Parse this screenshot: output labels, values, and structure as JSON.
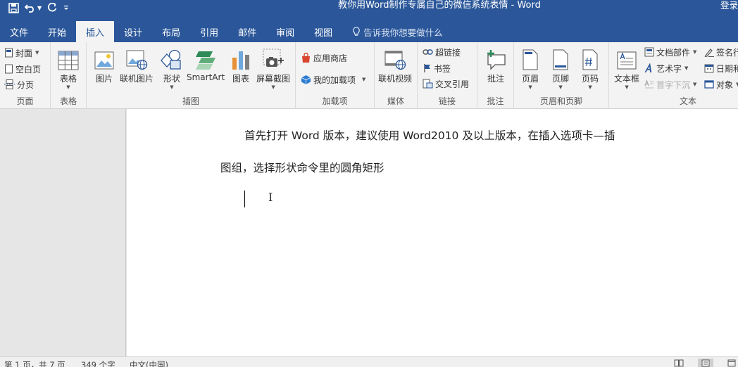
{
  "titlebar": {
    "title": "教你用Word制作专属自己的微信系统表情 - Word",
    "login": "登录"
  },
  "tabs": {
    "file": "文件",
    "items": [
      "开始",
      "插入",
      "设计",
      "布局",
      "引用",
      "邮件",
      "审阅",
      "视图"
    ],
    "active": "插入",
    "tellme": "告诉我你想要做什么"
  },
  "ribbon": {
    "pages": {
      "label": "页面",
      "cover": "封面",
      "blank": "空白页",
      "break": "分页"
    },
    "tables": {
      "label": "表格",
      "table": "表格"
    },
    "illustrations": {
      "label": "插图",
      "picture": "图片",
      "online_picture": "联机图片",
      "shapes": "形状",
      "smartart": "SmartArt",
      "chart": "图表",
      "screenshot": "屏幕截图"
    },
    "addins": {
      "label": "加载项",
      "store": "应用商店",
      "my_addins": "我的加载项"
    },
    "media": {
      "label": "媒体",
      "online_video": "联机视频"
    },
    "links": {
      "label": "链接",
      "hyperlink": "超链接",
      "bookmark": "书签",
      "cross_ref": "交叉引用"
    },
    "comments": {
      "label": "批注",
      "comment": "批注"
    },
    "header_footer": {
      "label": "页眉和页脚",
      "header": "页眉",
      "footer": "页脚",
      "page_number": "页码"
    },
    "text": {
      "label": "文本",
      "textbox": "文本框",
      "quick_parts": "文档部件",
      "wordart": "艺术字",
      "dropcap": "首字下沉",
      "signature": "签名行",
      "datetime": "日期和时间",
      "object": "对象"
    }
  },
  "document": {
    "line1": "首先打开 Word 版本，建议使用 Word2010 及以上版本，在插入选项卡—插",
    "line2": "图组，选择形状命令里的圆角矩形"
  },
  "statusbar": {
    "page": "第 1 页，共 7 页",
    "words": "349 个字",
    "language": "中文(中国)"
  },
  "colors": {
    "accent": "#2b579a",
    "ribbon_bg": "#f3f3f3"
  }
}
